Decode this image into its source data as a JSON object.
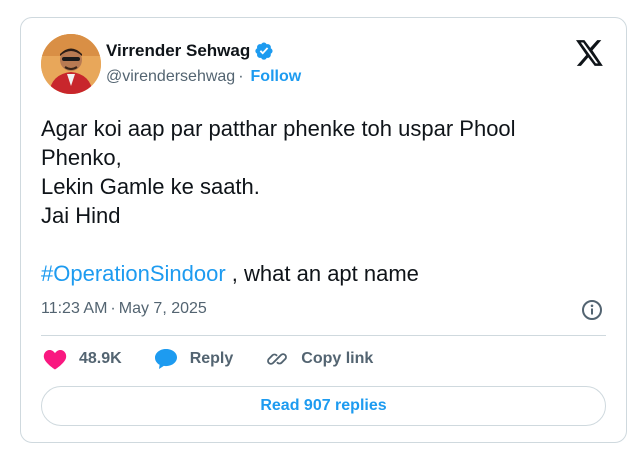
{
  "author": {
    "name": "Virrender Sehwag",
    "handle": "@virendersehwag",
    "separator": "·",
    "follow_label": "Follow"
  },
  "tweet": {
    "lines": [
      "Agar koi aap par patthar phenke toh uspar Phool",
      "Phenko,",
      "Lekin Gamle ke saath.",
      "Jai Hind"
    ],
    "hashtag": "#OperationSindoor",
    "hashtag_suffix": " , what an apt name"
  },
  "meta": {
    "time": "11:23 AM",
    "separator": "·",
    "date": "May 7, 2025"
  },
  "actions": {
    "likes": "48.9K",
    "reply_label": "Reply",
    "copy_label": "Copy link"
  },
  "replies_button": "Read 907 replies",
  "colors": {
    "accent": "#1d9bf0",
    "like": "#f91880",
    "text": "#0f1419",
    "muted": "#536471",
    "border": "#cfd9de"
  },
  "icons": [
    "verified-badge-icon",
    "x-logo-icon",
    "info-icon",
    "heart-icon",
    "reply-bubble-icon",
    "link-icon"
  ]
}
